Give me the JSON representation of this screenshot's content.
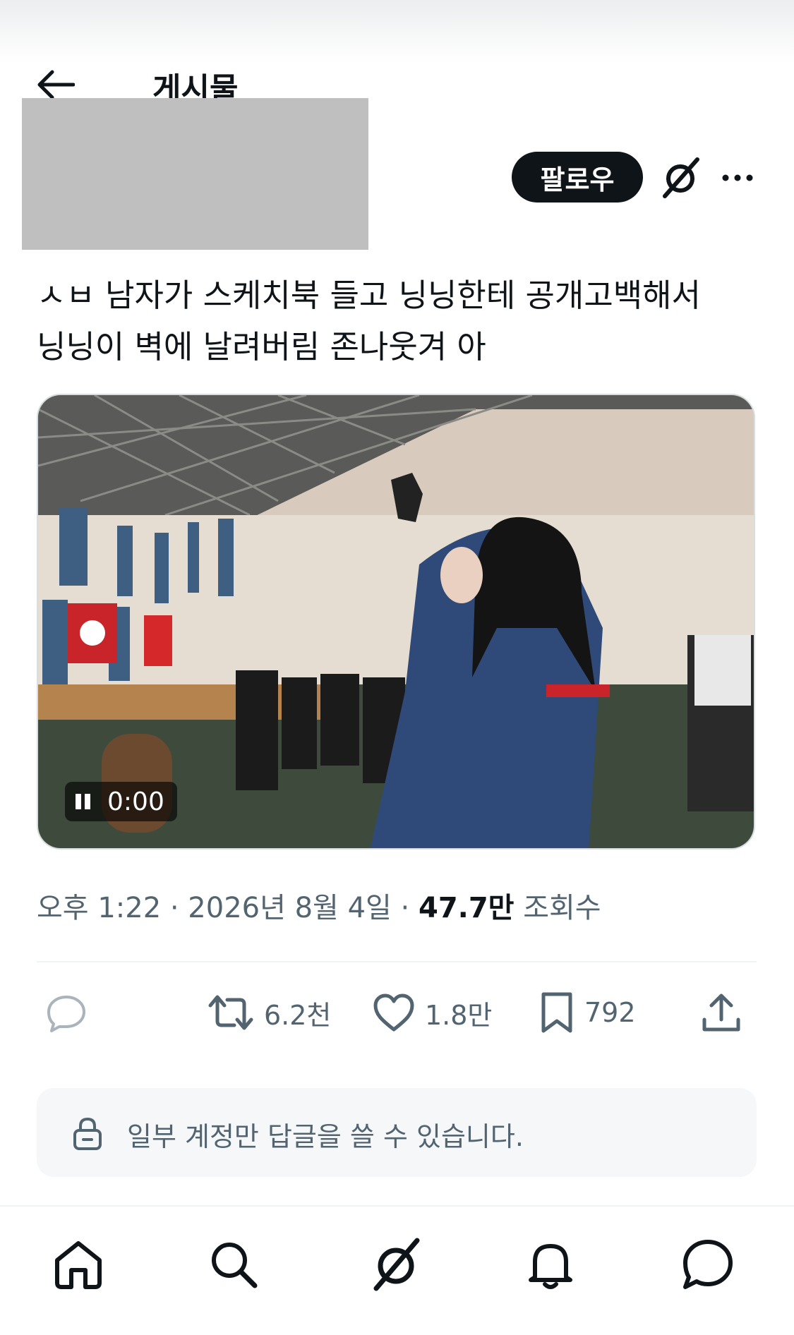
{
  "header": {
    "title": "게시물"
  },
  "post": {
    "follow_label": "팔로우",
    "text_line1": "ㅅㅂ 남자가 스케치북 들고 닝닝한테 공개고백해서",
    "text_line2": "닝닝이 벽에 날려버림 존나웃겨 아",
    "video": {
      "time": "0:00",
      "playing": true
    },
    "meta": {
      "time": "오후 1:22",
      "sep": "·",
      "date": "2026년 8월 4일",
      "views_value": "47.7만",
      "views_label": "조회수"
    }
  },
  "actions": {
    "retweets": "6.2천",
    "likes": "1.8만",
    "bookmarks": "792"
  },
  "reply_notice": "일부 계정만 답글을 쓸 수 있습니다.",
  "icons": [
    "back-arrow-icon",
    "grok-icon",
    "more-icon",
    "reply-icon",
    "retweet-icon",
    "heart-icon",
    "bookmark-icon",
    "share-icon",
    "lock-icon",
    "home-icon",
    "search-icon",
    "bell-icon",
    "messages-icon"
  ],
  "colors": {
    "primary_text": "#0f1419",
    "secondary_text": "#536471",
    "divider": "#eff3f4"
  }
}
